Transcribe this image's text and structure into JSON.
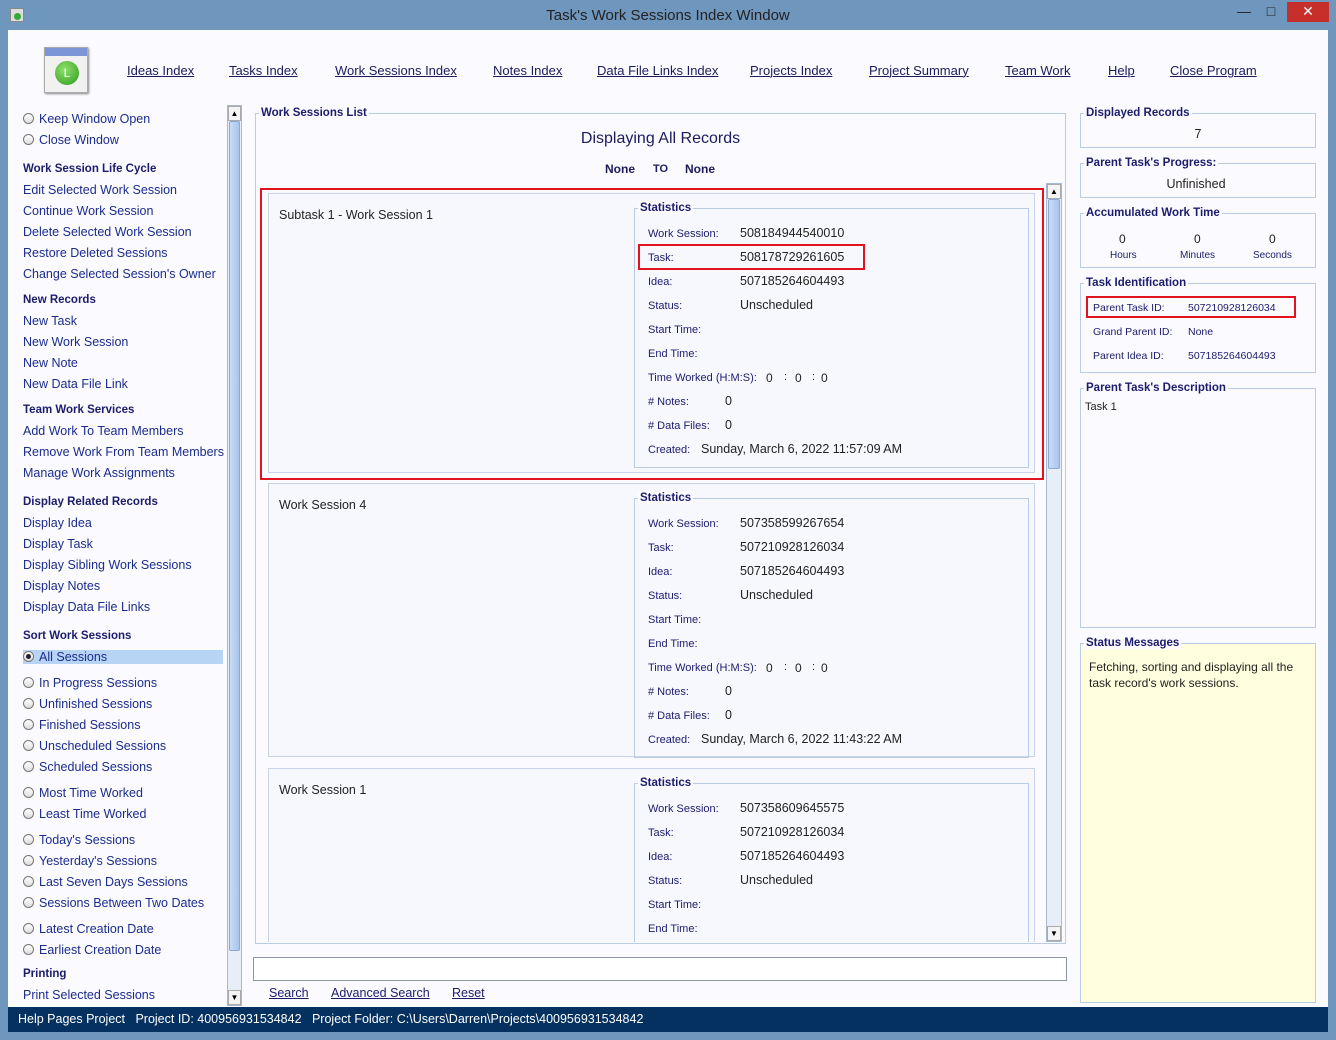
{
  "window": {
    "title": "Task's Work Sessions Index Window",
    "minimize": "—",
    "maximize": "□",
    "close": "✕"
  },
  "menu": [
    "Ideas Index",
    "Tasks Index",
    "Work Sessions Index",
    "Notes Index",
    "Data File Links Index",
    "Projects Index",
    "Project Summary",
    "Team Work",
    "Help",
    "Close Program"
  ],
  "sidebar": [
    {
      "t": "radio",
      "label": "Keep Window Open",
      "on": false
    },
    {
      "t": "radio",
      "label": "Close Window",
      "on": false
    },
    {
      "t": "h",
      "label": "Work Session Life Cycle"
    },
    {
      "t": "i",
      "label": "Edit Selected Work Session"
    },
    {
      "t": "i",
      "label": "Continue Work Session"
    },
    {
      "t": "i",
      "label": "Delete Selected Work Session"
    },
    {
      "t": "i",
      "label": "Restore Deleted Sessions"
    },
    {
      "t": "i",
      "label": "Change Selected Session's Owner"
    },
    {
      "t": "h",
      "label": "New Records"
    },
    {
      "t": "i",
      "label": "New Task"
    },
    {
      "t": "i",
      "label": "New Work Session"
    },
    {
      "t": "i",
      "label": "New Note"
    },
    {
      "t": "i",
      "label": "New Data File Link"
    },
    {
      "t": "h",
      "label": "Team Work Services"
    },
    {
      "t": "i",
      "label": "Add Work To Team Members"
    },
    {
      "t": "i",
      "label": "Remove Work From Team Members"
    },
    {
      "t": "i",
      "label": "Manage Work Assignments"
    },
    {
      "t": "h",
      "label": "Display Related Records"
    },
    {
      "t": "i",
      "label": "Display Idea"
    },
    {
      "t": "i",
      "label": "Display Task"
    },
    {
      "t": "i",
      "label": "Display Sibling Work Sessions"
    },
    {
      "t": "i",
      "label": "Display Notes"
    },
    {
      "t": "i",
      "label": "Display Data File Links"
    },
    {
      "t": "h",
      "label": "Sort Work Sessions"
    },
    {
      "t": "radio",
      "label": "All Sessions",
      "on": true
    },
    {
      "t": "radio",
      "label": "In Progress Sessions",
      "on": false
    },
    {
      "t": "radio",
      "label": "Unfinished Sessions",
      "on": false
    },
    {
      "t": "radio",
      "label": "Finished Sessions",
      "on": false
    },
    {
      "t": "radio",
      "label": "Unscheduled Sessions",
      "on": false
    },
    {
      "t": "radio",
      "label": "Scheduled Sessions",
      "on": false
    },
    {
      "t": "radio",
      "label": "Most Time Worked",
      "on": false
    },
    {
      "t": "radio",
      "label": "Least Time Worked",
      "on": false
    },
    {
      "t": "radio",
      "label": "Today's Sessions",
      "on": false
    },
    {
      "t": "radio",
      "label": "Yesterday's Sessions",
      "on": false
    },
    {
      "t": "radio",
      "label": "Last Seven Days Sessions",
      "on": false
    },
    {
      "t": "radio",
      "label": "Sessions Between Two Dates",
      "on": false
    },
    {
      "t": "radio",
      "label": "Latest Creation Date",
      "on": false
    },
    {
      "t": "radio",
      "label": "Earliest Creation Date",
      "on": false
    },
    {
      "t": "h",
      "label": "Printing"
    },
    {
      "t": "i",
      "label": "Print Selected Sessions"
    }
  ],
  "list": {
    "legend": "Work Sessions List",
    "heading": "Displaying All Records",
    "range_from": "None",
    "range_to_label": "TO",
    "range_to": "None",
    "stats_legend": "Statistics",
    "labels": {
      "ws": "Work Session:",
      "task": "Task:",
      "idea": "Idea:",
      "status": "Status:",
      "start": "Start Time:",
      "end": "End Time:",
      "tw": "Time Worked (H:M:S):",
      "notes": "# Notes:",
      "files": "# Data Files:",
      "created": "Created:"
    },
    "cards": [
      {
        "name": "Subtask 1 - Work Session 1",
        "ws": "508184944540010",
        "task": "508178729261605",
        "idea": "507185264604493",
        "status": "Unscheduled",
        "start": "",
        "end": "",
        "h": "0",
        "m": "0",
        "s": "0",
        "notes": "0",
        "files": "0",
        "created": "Sunday, March 6, 2022   11:57:09 AM"
      },
      {
        "name": "Work Session 4",
        "ws": "507358599267654",
        "task": "507210928126034",
        "idea": "507185264604493",
        "status": "Unscheduled",
        "start": "",
        "end": "",
        "h": "0",
        "m": "0",
        "s": "0",
        "notes": "0",
        "files": "0",
        "created": "Sunday, March 6, 2022   11:43:22 AM"
      },
      {
        "name": "Work Session 1",
        "ws": "507358609645575",
        "task": "507210928126034",
        "idea": "507185264604493",
        "status": "Unscheduled",
        "start": "",
        "end": ""
      }
    ]
  },
  "search": {
    "value": "",
    "search": "Search",
    "advanced": "Advanced Search",
    "reset": "Reset"
  },
  "right": {
    "displayed": {
      "legend": "Displayed Records",
      "value": "7"
    },
    "progress": {
      "legend": "Parent Task's Progress:",
      "value": "Unfinished"
    },
    "accum": {
      "legend": "Accumulated Work Time",
      "hours": "0",
      "minutes": "0",
      "seconds": "0",
      "hours_label": "Hours",
      "minutes_label": "Minutes",
      "seconds_label": "Seconds"
    },
    "taskid": {
      "legend": "Task Identification",
      "parent_label": "Parent Task ID:",
      "parent": "507210928126034",
      "grand_label": "Grand Parent ID:",
      "grand": "None",
      "idea_label": "Parent Idea ID:",
      "idea": "507185264604493"
    },
    "desc": {
      "legend": "Parent Task's Description",
      "value": "Task 1"
    },
    "status": {
      "legend": "Status Messages",
      "value": "Fetching, sorting and displaying all the task record's work sessions."
    }
  },
  "statusbar": {
    "project": "Help Pages Project",
    "id": "Project ID: 400956931534842",
    "folder": "Project Folder: C:\\Users\\Darren\\Projects\\400956931534842"
  },
  "colors": {
    "titlebar": "#6f96bd",
    "statusbar": "#04315f",
    "highlight": "#e0141e",
    "selection": "#b8d4f5",
    "status_bg": "#ffffe0"
  }
}
